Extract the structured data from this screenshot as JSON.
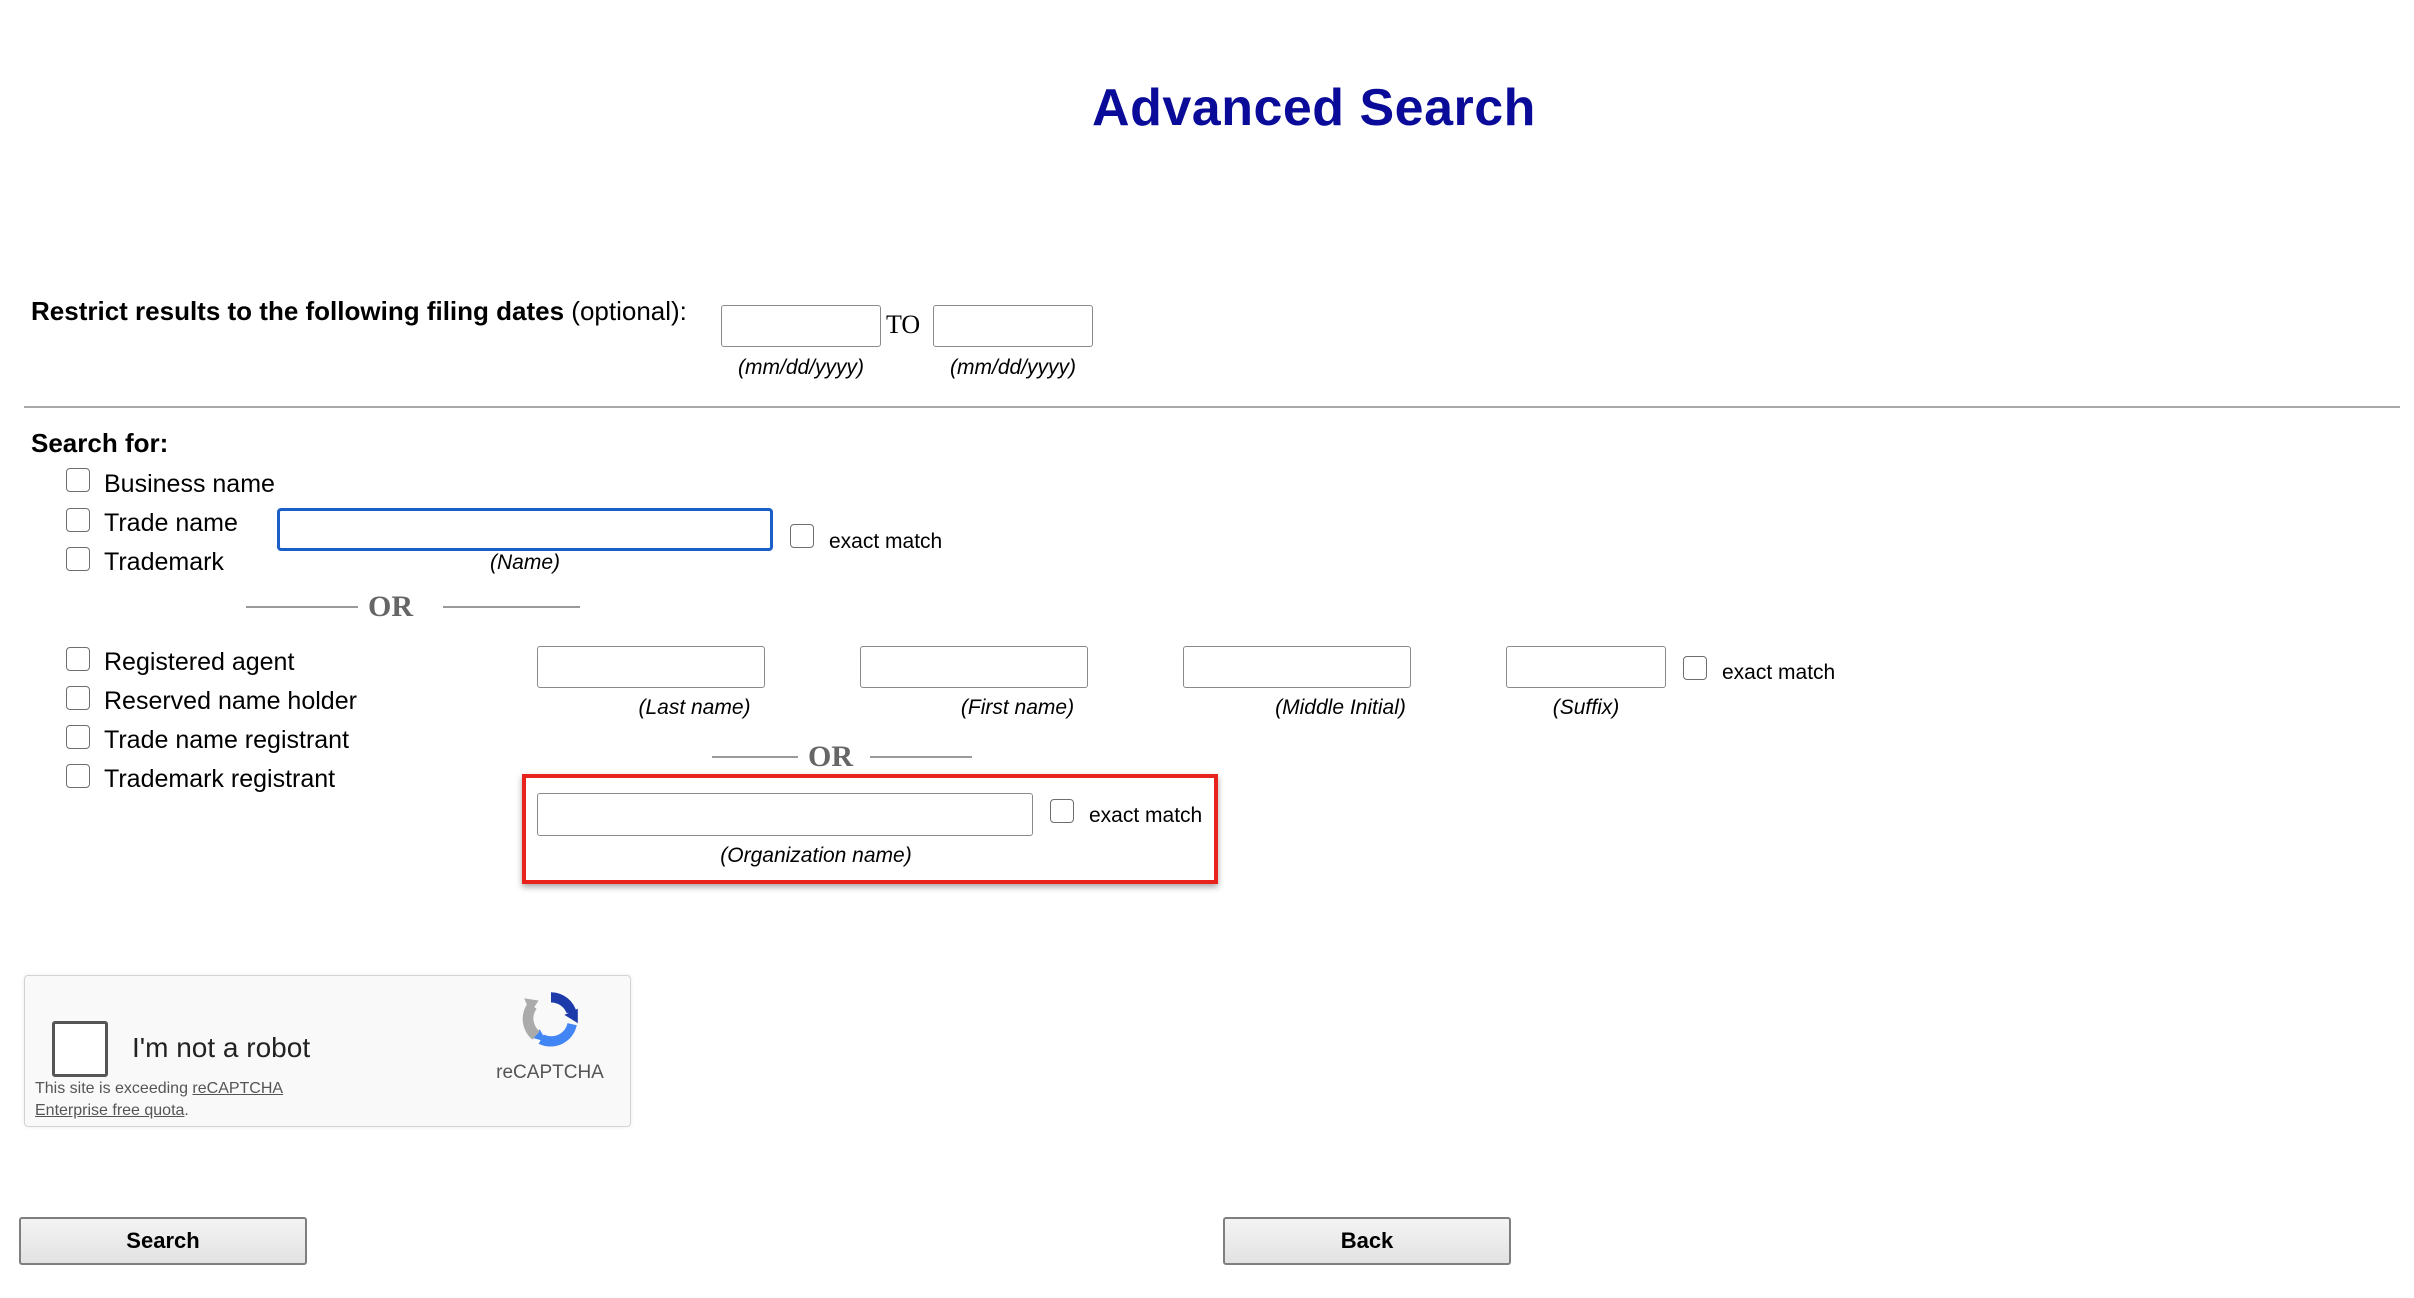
{
  "title": "Advanced Search",
  "filing_dates": {
    "label_bold": "Restrict results to the following filing dates",
    "label_rest": " (optional):",
    "from_value": "",
    "to_value": "",
    "to_label": "TO",
    "format_hint": "(mm/dd/yyyy)"
  },
  "search_for": {
    "label": "Search for:",
    "name_types": [
      "Business name",
      "Trade name",
      "Trademark"
    ],
    "name_value": "",
    "name_hint": "(Name)",
    "exact_match_label": "exact match",
    "or_label": "OR",
    "person_types": [
      "Registered agent",
      "Reserved name holder",
      "Trade name registrant",
      "Trademark registrant"
    ],
    "person_fields": {
      "last_name_hint": "(Last name)",
      "first_name_hint": "(First name)",
      "middle_initial_hint": "(Middle Initial)",
      "suffix_hint": "(Suffix)"
    },
    "organization_value": "",
    "organization_hint": "(Organization name)"
  },
  "captcha": {
    "label": "I'm not a robot",
    "brand": "reCAPTCHA",
    "warning_prefix": "This site is exceeding ",
    "warning_link_1": "reCAPTCHA",
    "warning_link_2": "Enterprise free quota",
    "warning_suffix": "."
  },
  "buttons": {
    "search": "Search",
    "back": "Back"
  },
  "colors": {
    "title": "#0b0b99",
    "focus_border": "#1a5fc8",
    "highlight": "#e8231d"
  },
  "icons": {
    "captcha_logo": "recaptcha-logo-icon"
  }
}
